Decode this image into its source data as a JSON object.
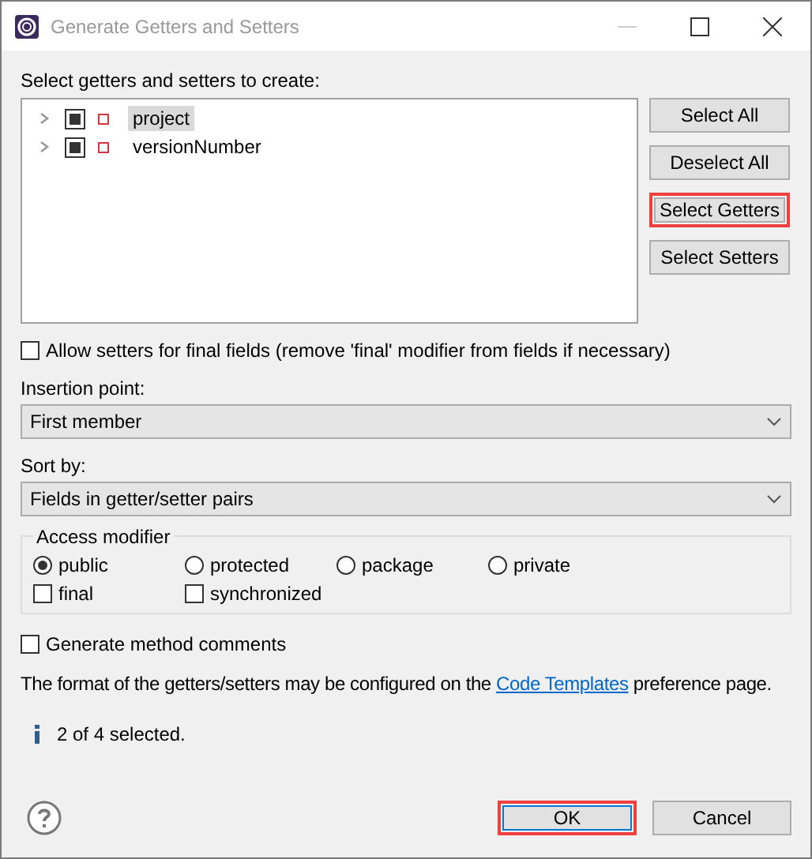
{
  "window": {
    "title": "Generate Getters and Setters"
  },
  "tree_label": "Select getters and setters to create:",
  "fields": [
    {
      "name": "project",
      "partial": true,
      "expanded": false,
      "selected": true
    },
    {
      "name": "versionNumber",
      "partial": true,
      "expanded": false,
      "selected": false
    }
  ],
  "side_buttons": [
    {
      "label": "Select All",
      "highlighted": false
    },
    {
      "label": "Deselect All",
      "highlighted": false
    },
    {
      "label": "Select Getters",
      "highlighted": true
    },
    {
      "label": "Select Setters",
      "highlighted": false
    }
  ],
  "allow_final": {
    "label": "Allow setters for final fields (remove 'final' modifier from fields if necessary)",
    "checked": false
  },
  "insertion_point": {
    "label": "Insertion point:",
    "value": "First member"
  },
  "sort_by": {
    "label": "Sort by:",
    "value": "Fields in getter/setter pairs"
  },
  "access_modifier": {
    "title": "Access modifier",
    "radios": [
      {
        "label": "public",
        "selected": true
      },
      {
        "label": "protected",
        "selected": false
      },
      {
        "label": "package",
        "selected": false
      },
      {
        "label": "private",
        "selected": false
      }
    ],
    "checks": [
      {
        "label": "final",
        "checked": false
      },
      {
        "label": "synchronized",
        "checked": false
      }
    ]
  },
  "comments": {
    "label": "Generate method comments",
    "checked": false
  },
  "format_note": {
    "before": "The format of the getters/setters may be configured on the",
    "link": "Code Templates",
    "after": "preference page."
  },
  "status": "2 of 4 selected.",
  "buttons": [
    {
      "label": "OK",
      "highlighted": true
    },
    {
      "label": "Cancel",
      "highlighted": false
    }
  ]
}
